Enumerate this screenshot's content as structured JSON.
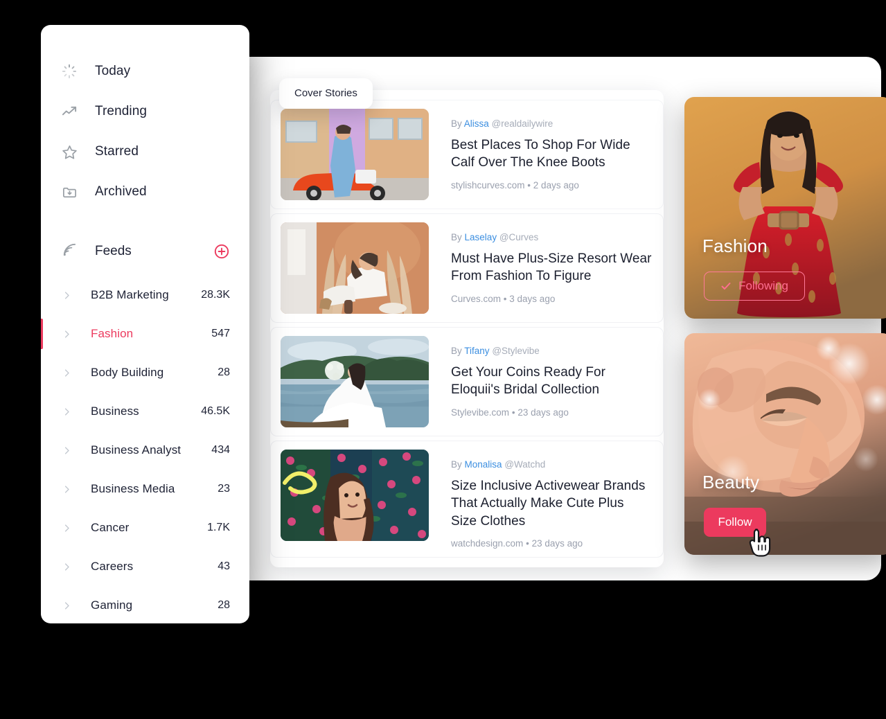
{
  "theme": {
    "background": "#000000",
    "accent": "#ec3a5e",
    "accent_soft": "#ff6f90",
    "link": "#3b8ee0",
    "text": "#1e2235",
    "muted": "#9aa0ae"
  },
  "sidebar": {
    "nav": [
      {
        "label": "Today",
        "icon": "today-spinner-icon"
      },
      {
        "label": "Trending",
        "icon": "trending-up-icon"
      },
      {
        "label": "Starred",
        "icon": "star-icon"
      },
      {
        "label": "Archived",
        "icon": "archive-folder-icon"
      }
    ],
    "feeds_header": {
      "label": "Feeds",
      "icon": "rss-icon",
      "add_icon": "plus-circle-icon"
    },
    "feeds": [
      {
        "label": "B2B Marketing",
        "count": "28.3K",
        "active": false
      },
      {
        "label": "Fashion",
        "count": "547",
        "active": true
      },
      {
        "label": "Body Building",
        "count": "28",
        "active": false
      },
      {
        "label": "Business",
        "count": "46.5K",
        "active": false
      },
      {
        "label": "Business Analyst",
        "count": "434",
        "active": false
      },
      {
        "label": "Business Media",
        "count": "23",
        "active": false
      },
      {
        "label": "Cancer",
        "count": "1.7K",
        "active": false
      },
      {
        "label": "Careers",
        "count": "43",
        "active": false
      },
      {
        "label": "Gaming",
        "count": "28",
        "active": false
      }
    ]
  },
  "cover_badge": {
    "label": "Cover Stories"
  },
  "articles": [
    {
      "by_prefix": "By",
      "author": "Alissa",
      "handle": "@realdailywire",
      "title": "Best Places To Shop For Wide Calf Over The Knee Boots",
      "source": "stylishcurves.com",
      "age": "2 days ago",
      "thumb": "woman-blue-jacket-orange-car"
    },
    {
      "by_prefix": "By",
      "author": "Laselay",
      "handle": "@Curves",
      "title": "Must Have Plus-Size Resort Wear From Fashion To Figure",
      "source": "Curves.com",
      "age": "3 days ago",
      "thumb": "woman-white-outfit-pampas"
    },
    {
      "by_prefix": "By",
      "author": "Tifany",
      "handle": "@Stylevibe",
      "title": "Get Your Coins Ready For Eloquii's Bridal Collection",
      "source": "Stylevibe.com",
      "age": "23 days ago",
      "thumb": "bride-lake-forest"
    },
    {
      "by_prefix": "By",
      "author": "Monalisa",
      "handle": "@Watchd",
      "title": "Size Inclusive Activewear Brands That Actually Make Cute Plus Size Clothes",
      "source": "watchdesign.com",
      "age": "23 days ago",
      "thumb": "woman-neon-floral-wall"
    }
  ],
  "topics": [
    {
      "label": "Fashion",
      "button": "Following",
      "state": "following",
      "icon": "check-icon",
      "image": "woman-red-dress-amber-background"
    },
    {
      "label": "Beauty",
      "button": "Follow",
      "state": "not-following",
      "icon": "none",
      "image": "closeup-face-warm-peach"
    }
  ],
  "cursor": {
    "icon": "pointing-hand-cursor"
  },
  "separator": "•"
}
